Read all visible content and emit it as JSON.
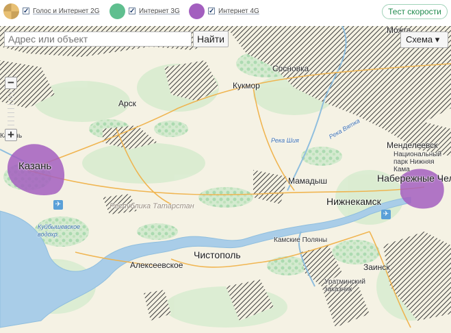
{
  "legend": {
    "items": [
      {
        "label": "Голос и Интернет 2G",
        "color": "#e8c074",
        "checked": "✓"
      },
      {
        "label": "Интернет 3G",
        "color": "#5fbf8f",
        "checked": "✓"
      },
      {
        "label": "Интернет 4G",
        "color": "#a35fbf",
        "checked": "✓"
      }
    ]
  },
  "speed_test_label": "Тест скорости",
  "search": {
    "placeholder": "Адрес или объект",
    "button_label": "Найти"
  },
  "map_type": {
    "label": "Схема ▾"
  },
  "zoom": {
    "in_label": "+",
    "out_label": "−"
  },
  "places": {
    "moscow_label": "Можга",
    "sosnovka": "Сосновка",
    "kukmor": "Кукмор",
    "arsk": "Арск",
    "kazan": "Казань",
    "kazan_small": "Казань",
    "mamadysh": "Мамадыш",
    "mendeleevsk": "Менделеевск",
    "national_park": "Национальный парк Нижняя Кама",
    "naberezhnye": "Набережные Челны",
    "nizhnekamsk": "Нижнекамск",
    "kamskie_polyany": "Камские Поляны",
    "chistopol": "Чистополь",
    "alekseevskoe": "Алексеевское",
    "zainsk": "Заинск",
    "reserve": "Уратминский заказник",
    "republic": "Республика Татарстан"
  },
  "water": {
    "vyatka": "Река Вятка",
    "shoshma": "Река Шия",
    "kuibyshev": "Куйбышевское водохр."
  },
  "icons": {
    "airport": "airplane-icon"
  }
}
